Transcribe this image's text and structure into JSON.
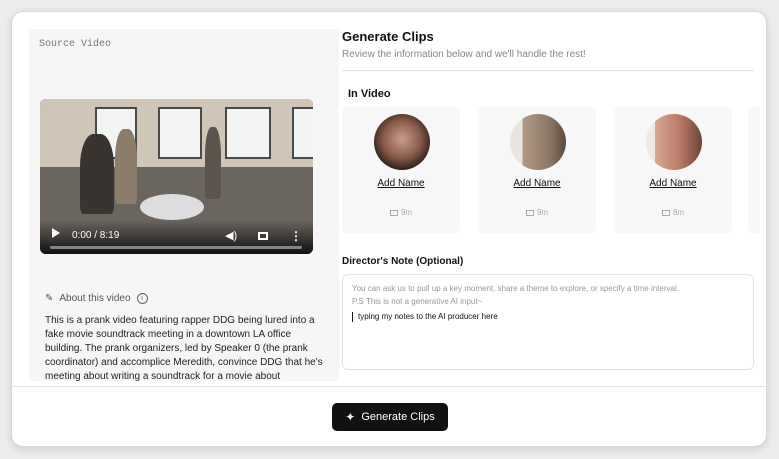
{
  "source": {
    "label": "Source Video",
    "time_display": "0:00 / 8:19",
    "progress_fraction": 0.0
  },
  "about": {
    "label": "About this video",
    "description": "This is a prank video featuring rapper DDG being lured into a fake movie soundtrack meeting in a downtown LA office building. The prank organizers, led by Speaker 0 (the prank coordinator) and accomplice Meredith, convince DDG that he's meeting about writing a soundtrack for a movie about"
  },
  "header": {
    "title": "Generate Clips",
    "subtitle": "Review the information below and we'll handle the rest!"
  },
  "in_video": {
    "label": "In Video",
    "people": [
      {
        "add_label": "Add Name",
        "duration": "9m"
      },
      {
        "add_label": "Add Name",
        "duration": "9m"
      },
      {
        "add_label": "Add Name",
        "duration": "8m"
      }
    ]
  },
  "note": {
    "label": "Director's Note (Optional)",
    "placeholder_line1": "You can ask us to pull up a key moment, share a theme to explore, or specify a time interval.",
    "placeholder_line2": "P.S This is not a generative AI input~",
    "value": "typing my notes to the AI producer here"
  },
  "footer": {
    "button_label": "Generate Clips"
  },
  "icons": {
    "pencil": "pencil-icon",
    "info": "info-icon",
    "monitor": "monitor-icon",
    "sparkle": "sparkle-icon"
  },
  "colors": {
    "primary_button": "#111111",
    "card_bg": "#f7f7f7"
  }
}
